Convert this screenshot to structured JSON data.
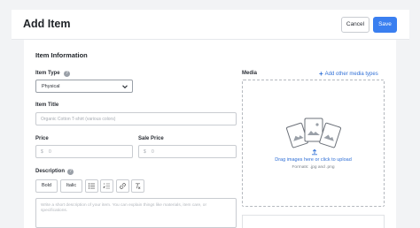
{
  "header": {
    "title": "Add Item",
    "cancel_label": "Cancel",
    "save_label": "Save"
  },
  "form": {
    "section_title": "Item Information",
    "item_type": {
      "label": "Item Type",
      "value": "Physical"
    },
    "item_title": {
      "label": "Item Title",
      "placeholder": "Organic Cotton T-shirt (various colors)"
    },
    "price": {
      "label": "Price",
      "currency": "$",
      "placeholder": "0"
    },
    "sale_price": {
      "label": "Sale Price",
      "currency": "$",
      "placeholder": "0"
    },
    "description": {
      "label": "Description",
      "toolbar": {
        "bold": "Bold",
        "italic": "Italic"
      },
      "placeholder": "Write a short description of your item. You can explain things like materials, item care, or specifications."
    }
  },
  "media": {
    "label": "Media",
    "add_link": "Add other media types",
    "upload_text": "Drag images here or click to upload",
    "formats": "Formats: .jpg and .png"
  },
  "colors": {
    "primary": "#3a7ff0",
    "link": "#2f6fd6"
  }
}
